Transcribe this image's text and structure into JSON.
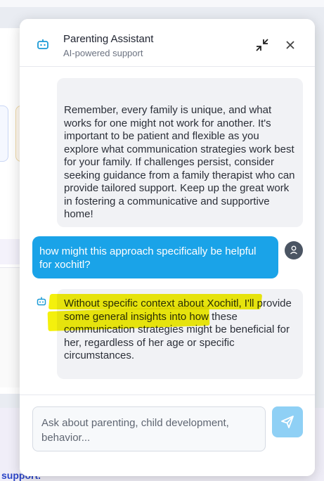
{
  "header": {
    "title": "Parenting Assistant",
    "subtitle": "AI-powered support"
  },
  "messages": [
    {
      "role": "assistant",
      "text": "Remember, every family is unique, and what works for one might not work for another. It's important to be patient and flexible as you explore what communication strategies work best for your family. If challenges persist, consider seeking guidance from a family therapist who can provide tailored support. Keep up the great work in fostering a communicative and supportive home!"
    },
    {
      "role": "user",
      "text": "how might this approach specifically be helpful for xochitl?"
    },
    {
      "role": "assistant",
      "text": "Without specific context about Xochitl, I'll provide some general insights into how these communication strategies might be beneficial for her, regardless of her age or specific circumstances."
    }
  ],
  "input": {
    "placeholder": "Ask about parenting, child development, behavior..."
  },
  "background": {
    "footer_fragment": "support."
  },
  "colors": {
    "user_bubble": "#1aa3e8",
    "send_button": "#8fd0f5",
    "highlight": "#f4f000"
  },
  "icons": {
    "header": "bot-icon",
    "minimize": "minimize-icon",
    "close": "close-icon",
    "user": "user-avatar-icon",
    "send": "send-icon"
  }
}
